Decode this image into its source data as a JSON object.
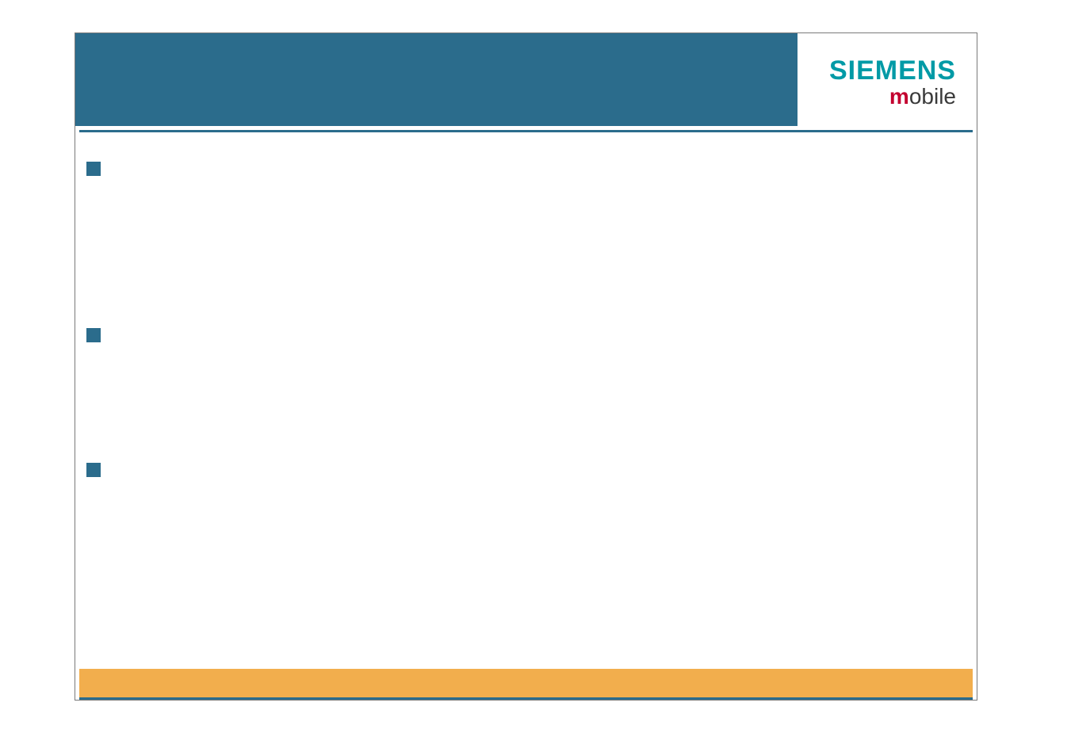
{
  "brand": {
    "name": "SIEMENS",
    "sub_prefix": "m",
    "sub_rest": "obile"
  },
  "colors": {
    "header": "#2b6c8c",
    "footer": "#f2ae4d",
    "accent_teal": "#009aa6",
    "accent_red": "#c3002f"
  }
}
